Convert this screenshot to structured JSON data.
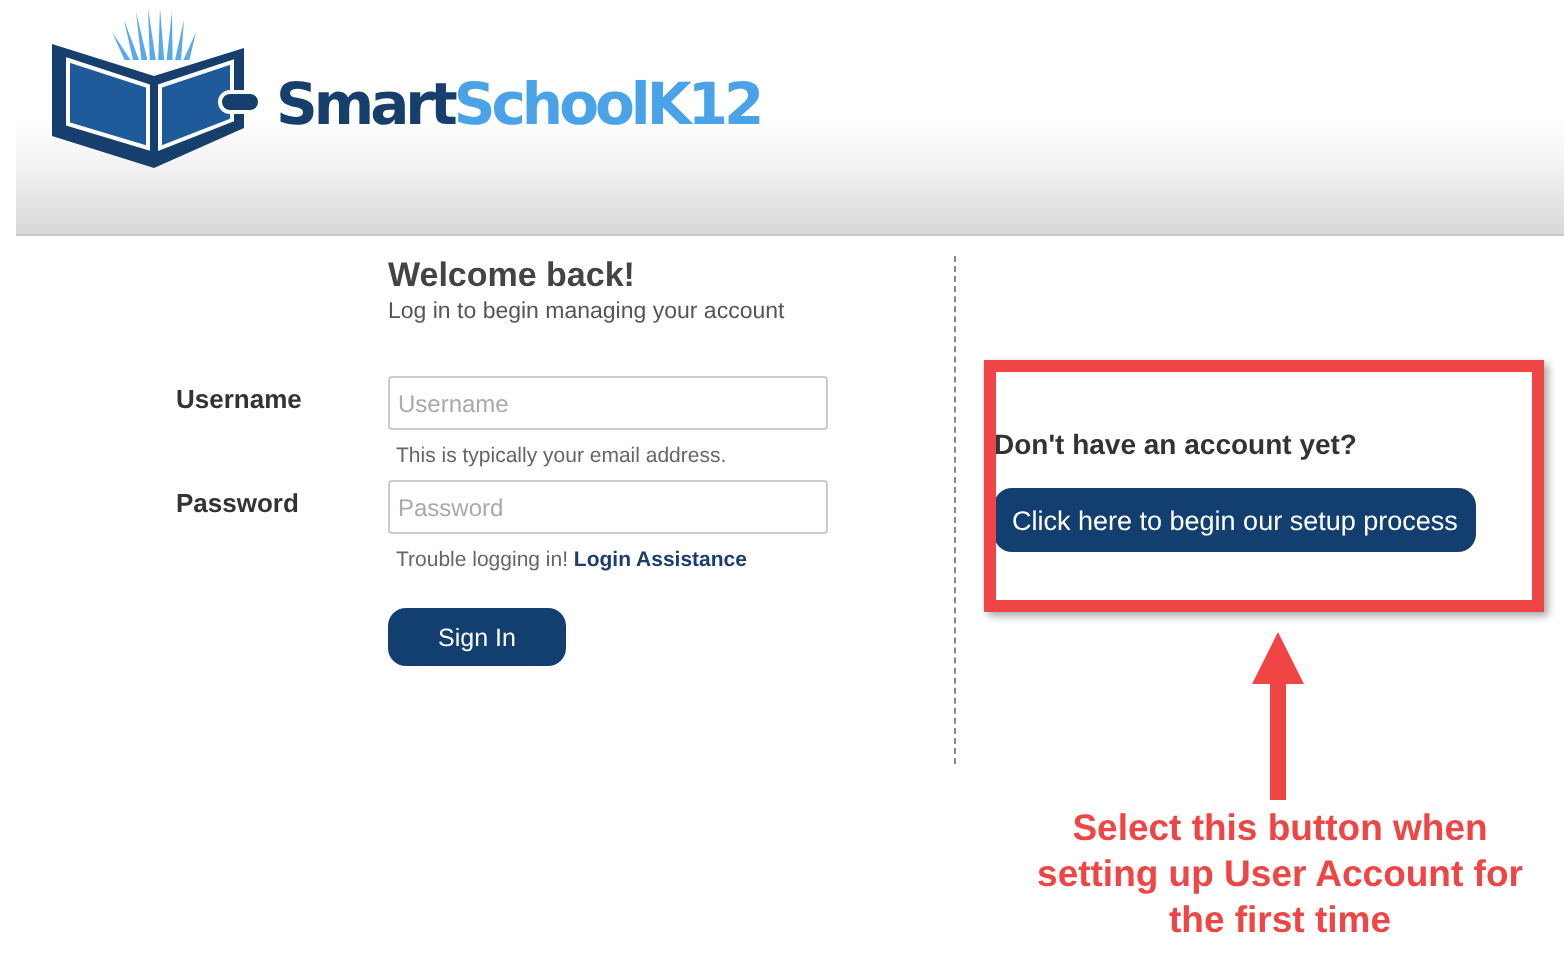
{
  "logo": {
    "brand_first": "Smart",
    "brand_second": "SchoolK12"
  },
  "login": {
    "title": "Welcome back!",
    "subtitle": "Log in to begin managing your account",
    "fields": [
      {
        "label": "Username",
        "placeholder": "Username",
        "hint": "This is typically your email address."
      },
      {
        "label": "Password",
        "placeholder": "Password",
        "hint": "Trouble logging in!",
        "link": "Login Assistance"
      }
    ],
    "button": "Sign In"
  },
  "signup": {
    "question": "Don't have an account yet?",
    "button": "Click here to begin our setup process"
  },
  "annotation": {
    "lines": [
      "Select this button when",
      "setting up User Account for",
      "the first time"
    ]
  }
}
